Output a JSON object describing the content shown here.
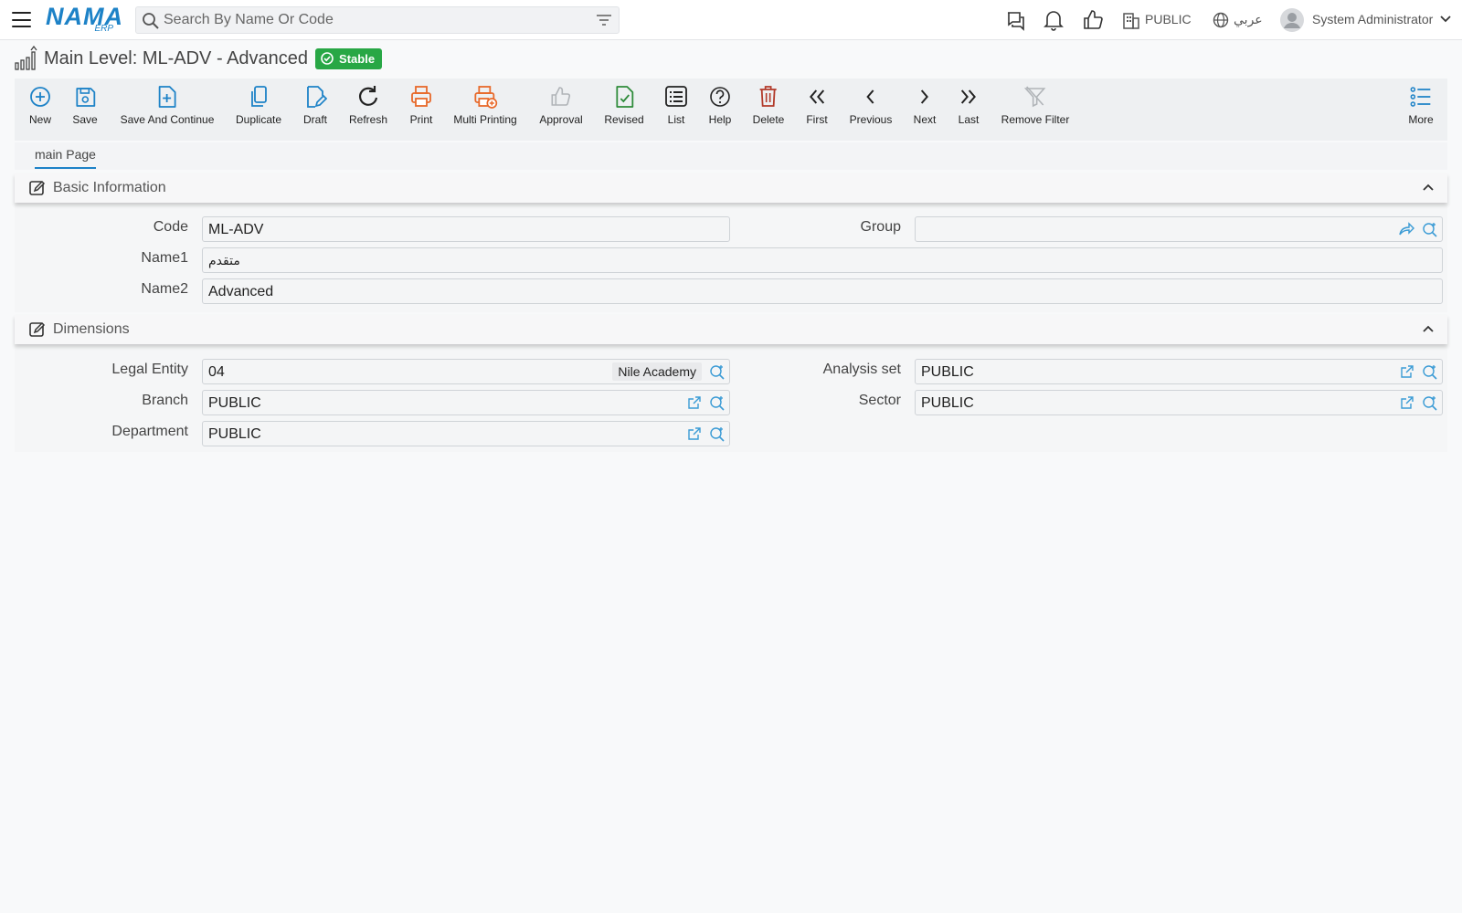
{
  "header": {
    "logo_text": "NAMA",
    "logo_sub": "ERP",
    "search_placeholder": "Search By Name Or Code",
    "branch": "PUBLIC",
    "language": "عربي",
    "user": "System Administrator"
  },
  "page": {
    "title": "Main Level: ML-ADV - Advanced",
    "status": "Stable"
  },
  "toolbar": {
    "new": "New",
    "save": "Save",
    "save_continue": "Save And Continue",
    "duplicate": "Duplicate",
    "draft": "Draft",
    "refresh": "Refresh",
    "print": "Print",
    "multi_printing": "Multi Printing",
    "approval": "Approval",
    "revised": "Revised",
    "list": "List",
    "help": "Help",
    "delete": "Delete",
    "first": "First",
    "previous": "Previous",
    "next": "Next",
    "last": "Last",
    "remove_filter": "Remove Filter",
    "more": "More"
  },
  "tabs": {
    "main": "main Page"
  },
  "basic": {
    "title": "Basic Information",
    "code_label": "Code",
    "code_value": "ML-ADV",
    "group_label": "Group",
    "group_value": "",
    "name1_label": "Name1",
    "name1_value": "متقدم",
    "name2_label": "Name2",
    "name2_value": "Advanced"
  },
  "dimensions": {
    "title": "Dimensions",
    "legal_entity_label": "Legal Entity",
    "legal_entity_value": "04",
    "legal_entity_name": "Nile Academy",
    "analysis_set_label": "Analysis set",
    "analysis_set_value": "PUBLIC",
    "branch_label": "Branch",
    "branch_value": "PUBLIC",
    "sector_label": "Sector",
    "sector_value": "PUBLIC",
    "department_label": "Department",
    "department_value": "PUBLIC"
  },
  "colors": {
    "accent": "#1d82c7",
    "stable": "#28a745",
    "print": "#e8692a",
    "revised": "#2e8b3a",
    "delete": "#b23a2a"
  }
}
